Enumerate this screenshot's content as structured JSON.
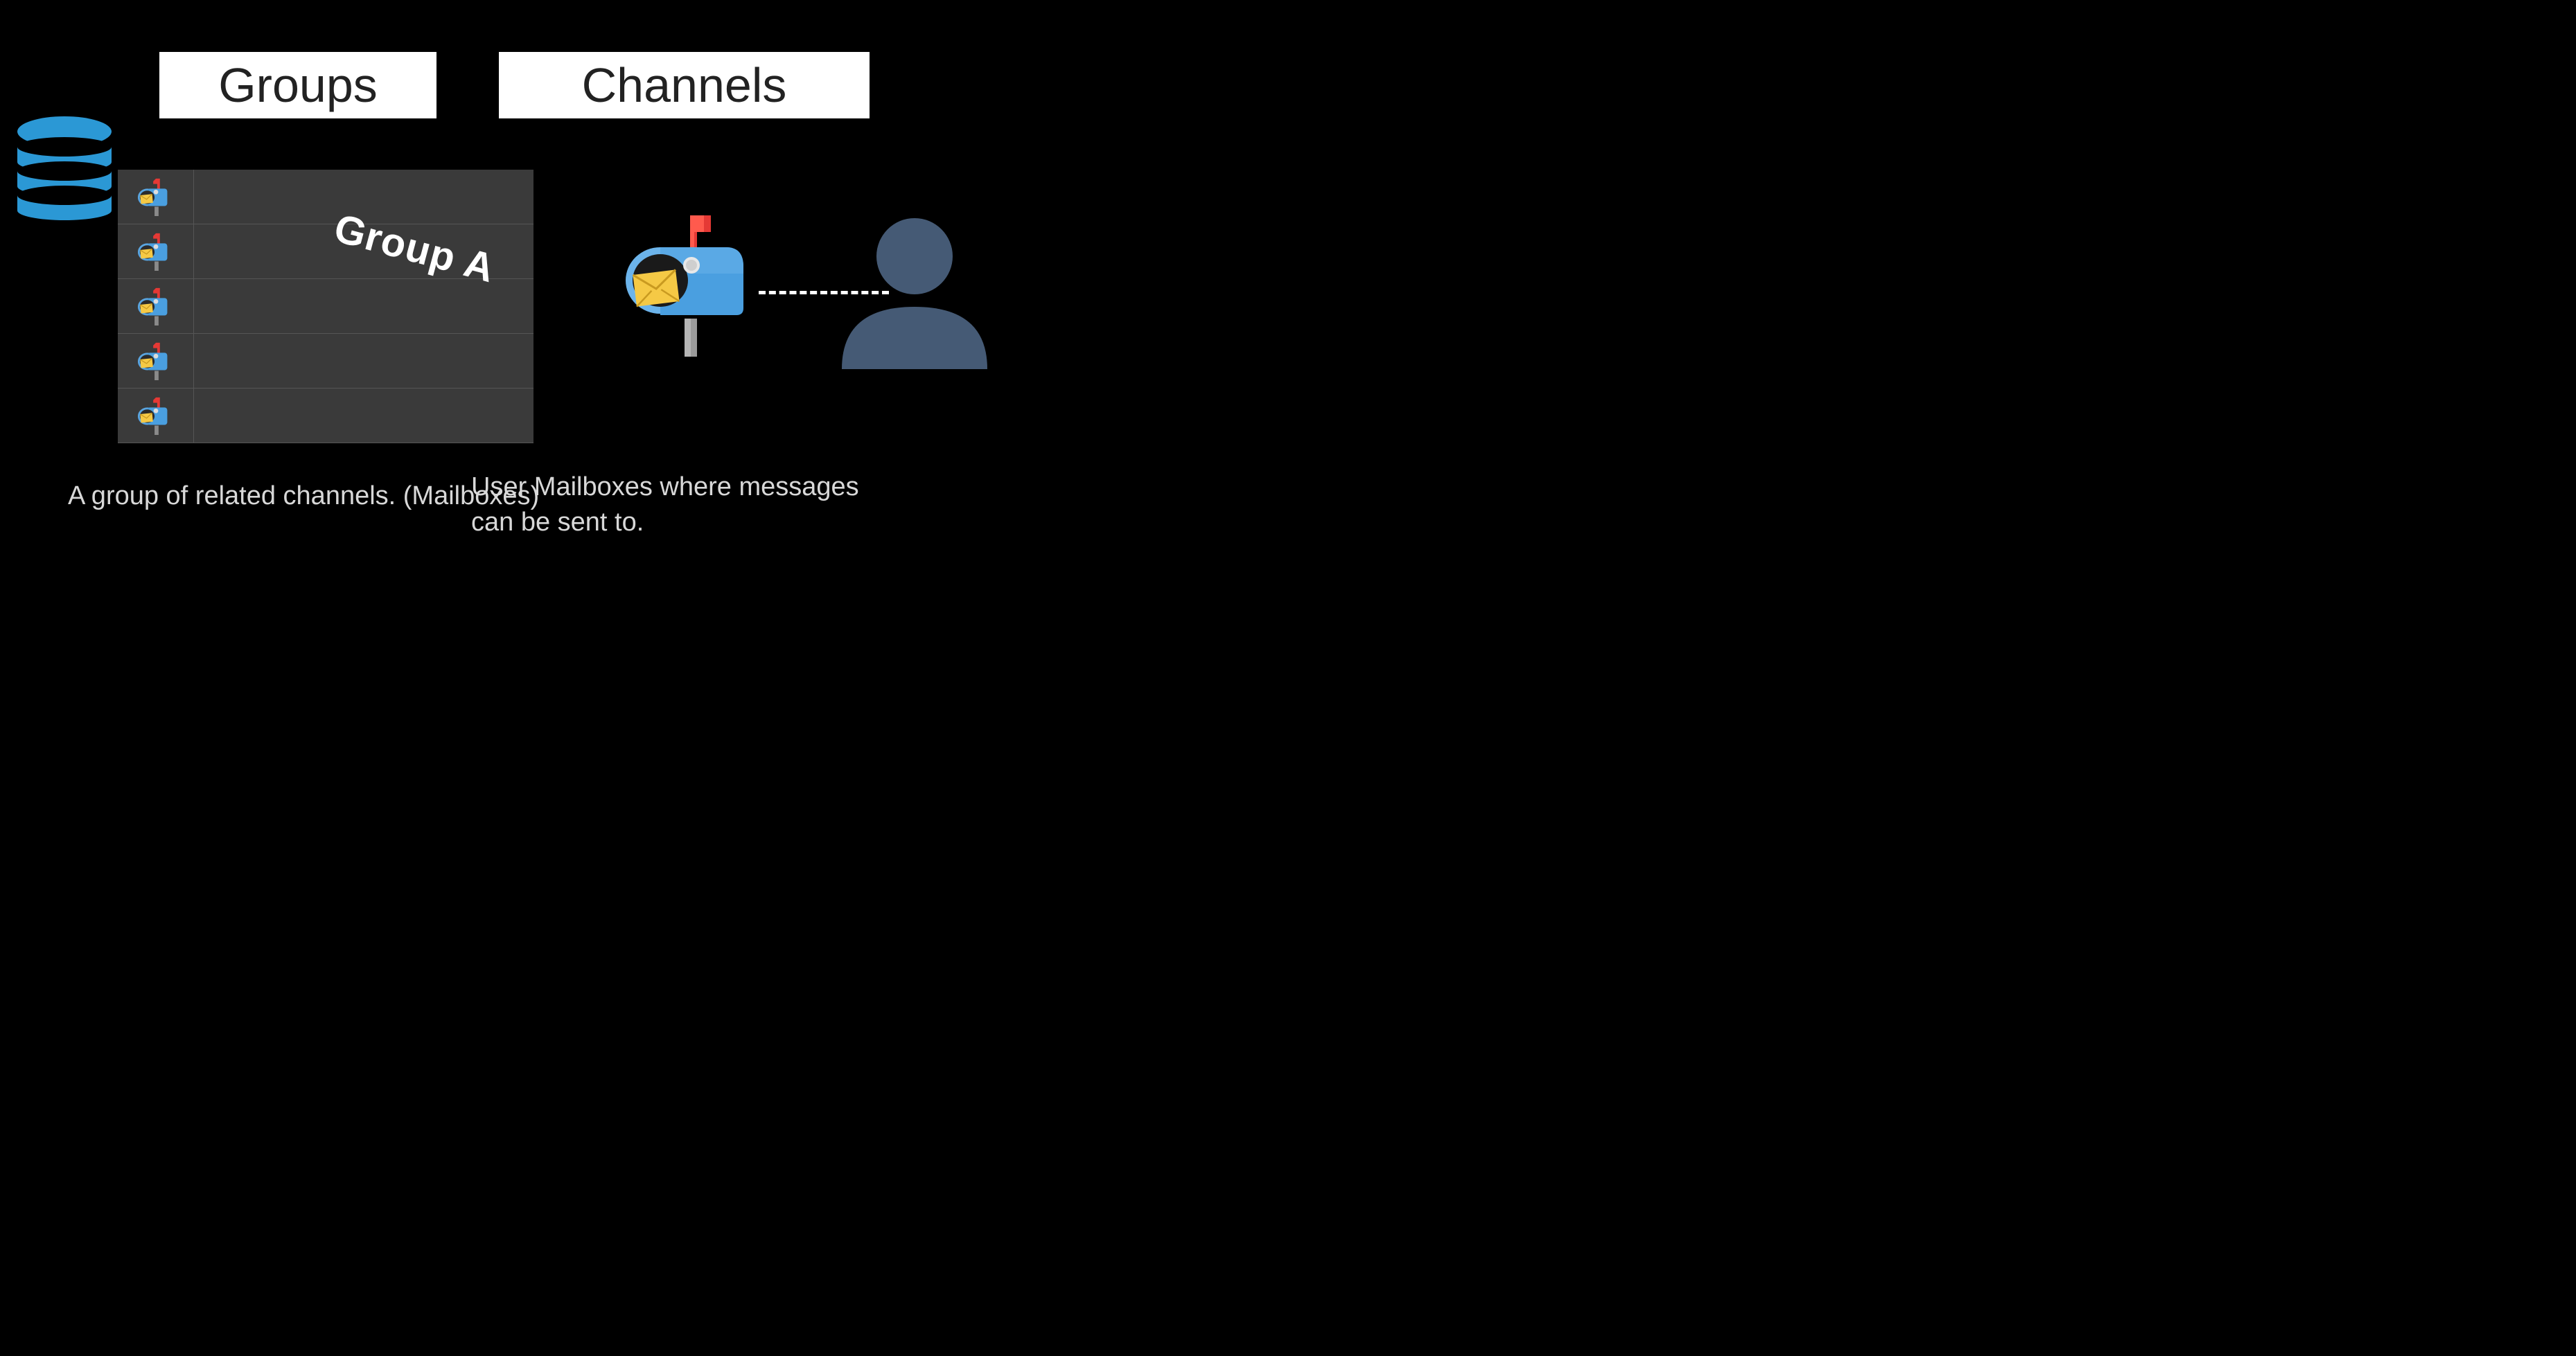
{
  "titles": {
    "groups": "Groups",
    "channels": "Channels"
  },
  "group_label": "Group A",
  "descriptions": {
    "groups": "A group of related channels. (Mailboxes)",
    "channels": "User Mailboxes where messages can be sent to."
  },
  "mailbox_rows": 5,
  "colors": {
    "accent_blue": "#2b98d5",
    "user_silhouette": "#455a75",
    "mailbox_body": "#4a9fe0",
    "mailbox_flag": "#e53935",
    "mailbox_envelope": "#f5c945"
  }
}
